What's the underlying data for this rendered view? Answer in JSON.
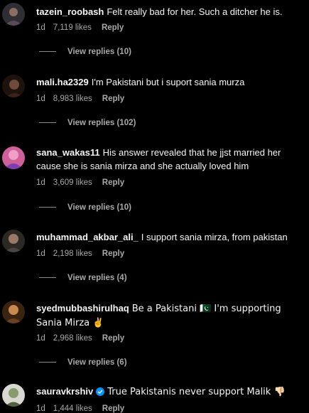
{
  "comments": [
    {
      "username": "tazein_roobash",
      "text": "Felt really bad for her. Such a ditcher he is.",
      "time": "1d",
      "likes": "7,119 likes",
      "reply_label": "Reply",
      "view_replies": "View replies (10)",
      "avatar_color": "#3a3a40"
    },
    {
      "username": "mali.ha2329",
      "text": "I'm Pakistani but i suport sania murza",
      "time": "1d",
      "likes": "8,983 likes",
      "reply_label": "Reply",
      "view_replies": "View replies (102)",
      "avatar_color": "#2a1a14"
    },
    {
      "username": "sana_wakas11",
      "text": "His answer revealed that he jjst married her cause she is sania mirza and she actually loved him",
      "time": "1d",
      "likes": "3,609 likes",
      "reply_label": "Reply",
      "view_replies": "View replies (10)",
      "avatar_color": "#c0507a"
    },
    {
      "username": "muhammad_akbar_ali_",
      "text": "I support sania mirza, from pakistan",
      "time": "1d",
      "likes": "2,198 likes",
      "reply_label": "Reply",
      "view_replies": "View replies (4)",
      "avatar_color": "#3b3530"
    },
    {
      "username": "syedmubbashirulhaq",
      "text": "Be a Pakistani 🇵🇰 I'm supporting Sania Mirza ✌️",
      "time": "1d",
      "likes": "2,968 likes",
      "reply_label": "Reply",
      "view_replies": "View replies (6)",
      "avatar_color": "#5a3a1a"
    },
    {
      "username": "sauravkrshiv",
      "verified": true,
      "text": "True Pakistanis never support Malik 👎🏻",
      "time": "1d",
      "likes": "1,444 likes",
      "reply_label": "Reply",
      "avatar_color": "#c8c8c0"
    }
  ],
  "colors": {
    "background": "#000000",
    "primary_text": "#f5f5f5",
    "secondary_text": "#a8a8a8",
    "verified_badge": "#0095f6"
  }
}
